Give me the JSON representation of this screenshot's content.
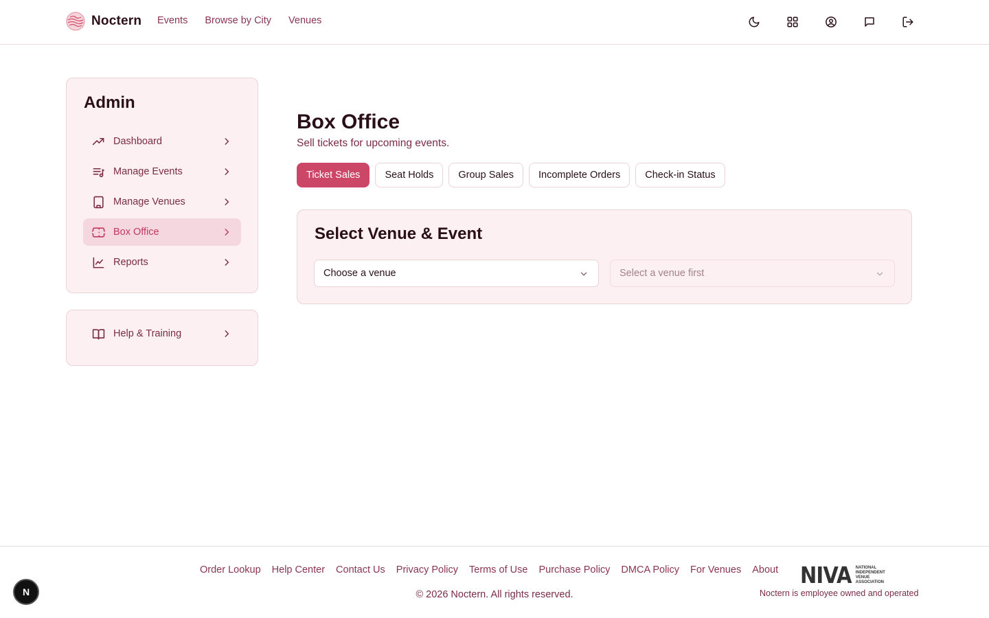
{
  "header": {
    "brand": "Noctern",
    "nav": [
      "Events",
      "Browse by City",
      "Venues"
    ],
    "icons": [
      "moon-icon",
      "grid-icon",
      "user-circle-icon",
      "message-icon",
      "logout-icon"
    ]
  },
  "sidebar": {
    "title": "Admin",
    "items": [
      {
        "label": "Dashboard",
        "icon": "trending-icon"
      },
      {
        "label": "Manage Events",
        "icon": "list-music-icon"
      },
      {
        "label": "Manage Venues",
        "icon": "building-icon"
      },
      {
        "label": "Box Office",
        "icon": "ticket-icon",
        "active": true
      },
      {
        "label": "Reports",
        "icon": "chart-line-icon"
      }
    ],
    "help": {
      "label": "Help & Training",
      "icon": "book-icon"
    }
  },
  "main": {
    "title": "Box Office",
    "subtitle": "Sell tickets for upcoming events.",
    "tabs": [
      {
        "label": "Ticket Sales",
        "active": true
      },
      {
        "label": "Seat Holds"
      },
      {
        "label": "Group Sales"
      },
      {
        "label": "Incomplete Orders"
      },
      {
        "label": "Check-in Status"
      }
    ],
    "select_card": {
      "title": "Select Venue & Event",
      "venue_select": "Choose a venue",
      "event_select": "Select a venue first"
    }
  },
  "footer": {
    "links": [
      "Order Lookup",
      "Help Center",
      "Contact Us",
      "Privacy Policy",
      "Terms of Use",
      "Purchase Policy",
      "DMCA Policy",
      "For Venues",
      "About"
    ],
    "copyright": "© 2026 Noctern. All rights reserved.",
    "niva": {
      "word": "NIVA",
      "sub": [
        "NATIONAL",
        "INDEPENDENT",
        "VENUE",
        "ASSOCIATION"
      ]
    },
    "employee_note": "Noctern is employee owned and operated"
  },
  "badge": "N",
  "colors": {
    "accent": "#cc4668",
    "text": "#2a0f18",
    "muted": "#7a2c45",
    "card_bg": "#fcf0f2"
  }
}
